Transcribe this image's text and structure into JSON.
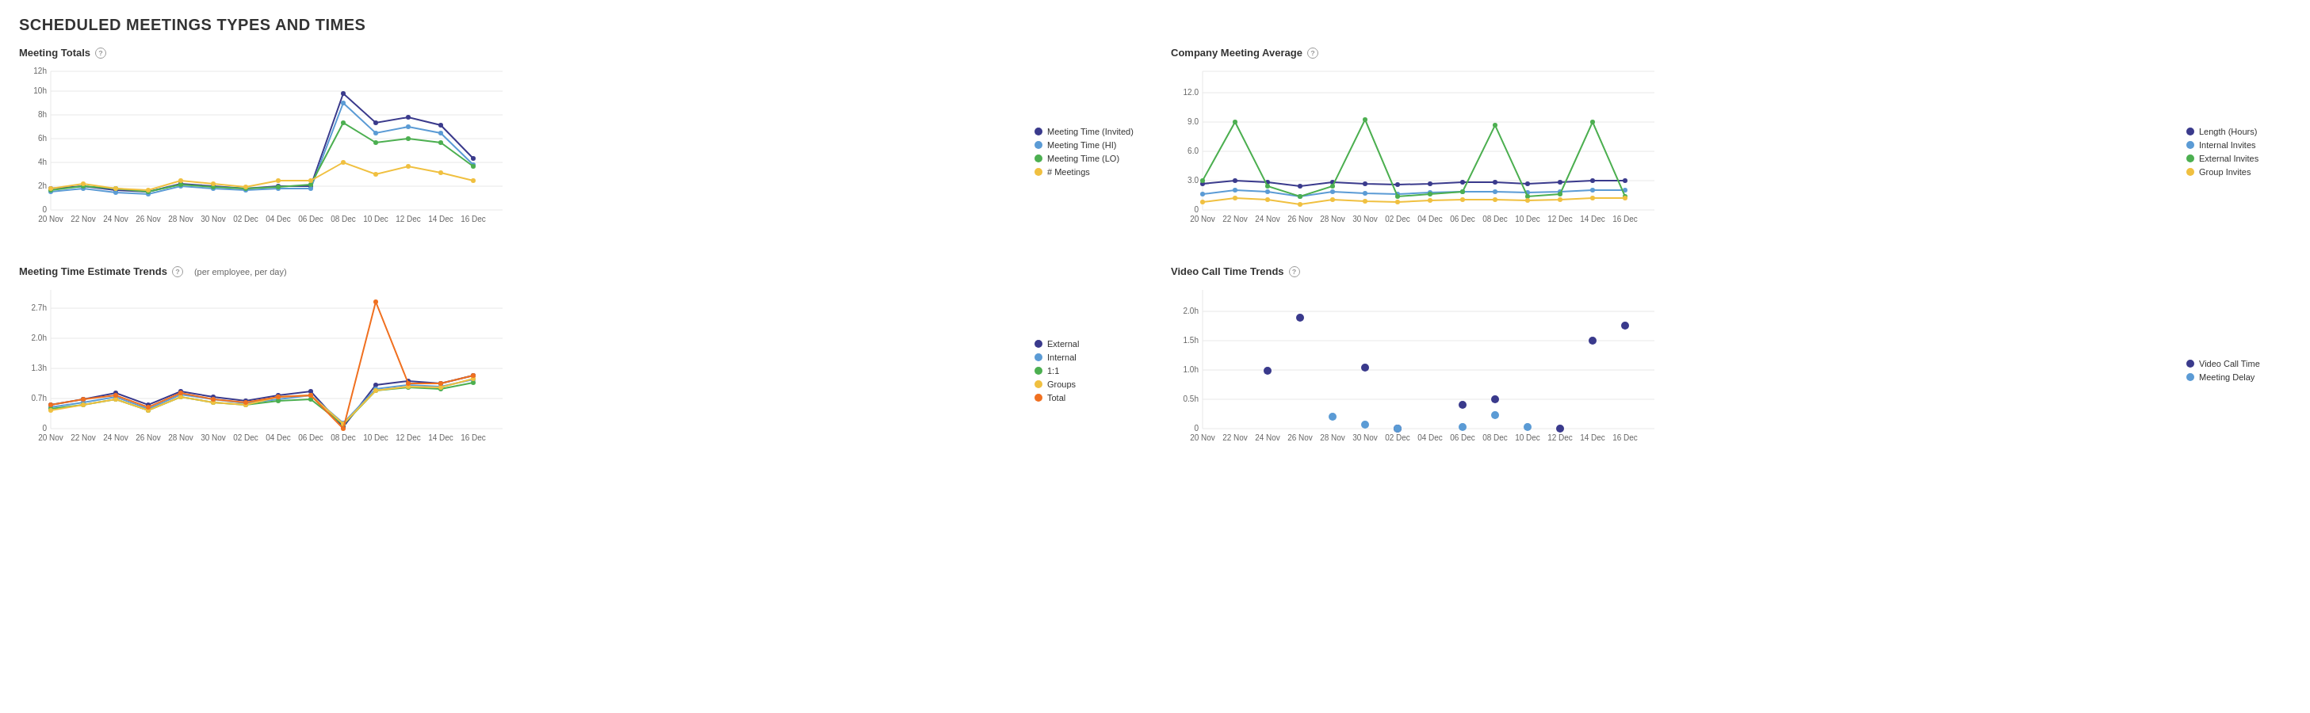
{
  "page": {
    "title": "SCHEDULED MEETINGS TYPES AND TIMES"
  },
  "charts": {
    "meeting_totals": {
      "title": "Meeting Totals",
      "yAxis": [
        "0",
        "2h",
        "4h",
        "6h",
        "8h",
        "10h",
        "12h"
      ],
      "xAxis": [
        "20 Nov",
        "22 Nov",
        "24 Nov",
        "26 Nov",
        "28 Nov",
        "30 Nov",
        "02 Dec",
        "04 Dec",
        "06 Dec",
        "08 Dec",
        "10 Dec",
        "12 Dec",
        "14 Dec",
        "16 Dec"
      ],
      "legend": [
        {
          "label": "Meeting Time (Invited)",
          "color": "#3a3a8c"
        },
        {
          "label": "Meeting Time (HI)",
          "color": "#5b9bd5"
        },
        {
          "label": "Meeting Time (LO)",
          "color": "#4caf50"
        },
        {
          "label": "# Meetings",
          "color": "#f0c040"
        }
      ]
    },
    "company_meeting_avg": {
      "title": "Company Meeting Average",
      "yAxis": [
        "0",
        "3.0",
        "6.0",
        "9.0",
        "12.0"
      ],
      "xAxis": [
        "20 Nov",
        "22 Nov",
        "24 Nov",
        "26 Nov",
        "28 Nov",
        "30 Nov",
        "02 Dec",
        "04 Dec",
        "06 Dec",
        "08 Dec",
        "10 Dec",
        "12 Dec",
        "14 Dec",
        "16 Dec"
      ],
      "legend": [
        {
          "label": "Length (Hours)",
          "color": "#3a3a8c"
        },
        {
          "label": "Internal Invites",
          "color": "#5b9bd5"
        },
        {
          "label": "External Invites",
          "color": "#4caf50"
        },
        {
          "label": "Group Invites",
          "color": "#f0c040"
        }
      ]
    },
    "meeting_time_estimate": {
      "title": "Meeting Time Estimate Trends",
      "subtitle": "(per employee, per day)",
      "yAxis": [
        "0",
        "0.7h",
        "1.3h",
        "2.0h",
        "2.7h"
      ],
      "xAxis": [
        "20 Nov",
        "22 Nov",
        "24 Nov",
        "26 Nov",
        "28 Nov",
        "30 Nov",
        "02 Dec",
        "04 Dec",
        "06 Dec",
        "08 Dec",
        "10 Dec",
        "12 Dec",
        "14 Dec",
        "16 Dec"
      ],
      "legend": [
        {
          "label": "External",
          "color": "#3a3a8c"
        },
        {
          "label": "Internal",
          "color": "#5b9bd5"
        },
        {
          "label": "1:1",
          "color": "#4caf50"
        },
        {
          "label": "Groups",
          "color": "#f0c040"
        },
        {
          "label": "Total",
          "color": "#f07020"
        }
      ]
    },
    "video_call_time": {
      "title": "Video Call Time Trends",
      "yAxis": [
        "0",
        "0.5h",
        "1.0h",
        "1.5h",
        "2.0h"
      ],
      "xAxis": [
        "20 Nov",
        "22 Nov",
        "24 Nov",
        "26 Nov",
        "28 Nov",
        "30 Nov",
        "02 Dec",
        "04 Dec",
        "06 Dec",
        "08 Dec",
        "10 Dec",
        "12 Dec",
        "14 Dec",
        "16 Dec"
      ],
      "legend": [
        {
          "label": "Video Call Time",
          "color": "#3a3a8c"
        },
        {
          "label": "Meeting Delay",
          "color": "#5b9bd5"
        }
      ]
    }
  }
}
